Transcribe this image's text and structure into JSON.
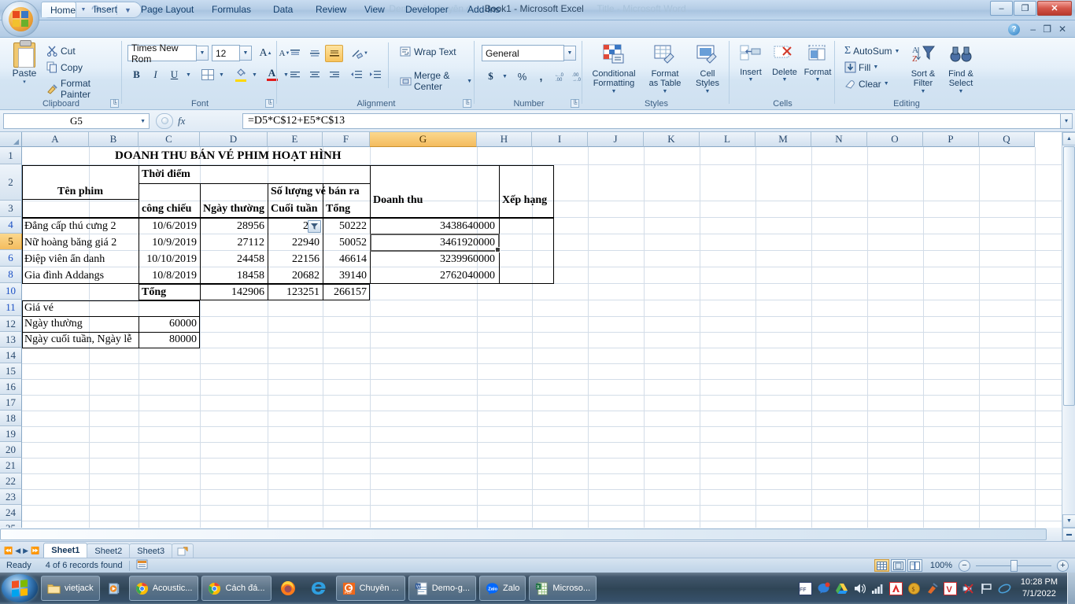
{
  "window": {
    "title": "Book1 - Microsoft Excel",
    "ghost_left": "Demo gửi chuyên đ",
    "ghost_right": "Title - Microsoft Word",
    "minimize": "–",
    "restore": "❐",
    "close": "✕"
  },
  "quick_access": {
    "save": "save-icon",
    "undo": "↶",
    "redo": "↷",
    "customize": "▾"
  },
  "ribbon": {
    "tabs": [
      {
        "label": "Home",
        "active": true
      },
      {
        "label": "Insert",
        "active": false
      },
      {
        "label": "Page Layout",
        "active": false
      },
      {
        "label": "Formulas",
        "active": false
      },
      {
        "label": "Data",
        "active": false
      },
      {
        "label": "Review",
        "active": false
      },
      {
        "label": "View",
        "active": false
      },
      {
        "label": "Developer",
        "active": false
      },
      {
        "label": "Add-Ins",
        "active": false
      }
    ],
    "help": "?",
    "min_ribbon": "–",
    "restore_ribbon": "❐",
    "close_ribbon": "✕",
    "groups": {
      "clipboard": {
        "label": "Clipboard",
        "paste": "Paste",
        "paste_arrow": "▾",
        "cut": "Cut",
        "copy": "Copy",
        "format_painter": "Format Painter"
      },
      "font": {
        "label": "Font",
        "font_name": "Times New Rom",
        "font_size": "12",
        "grow": "A",
        "shrink": "A",
        "bold": "B",
        "italic": "I",
        "underline": "U",
        "borders": "borders-icon",
        "fill_color": "fill-color-icon",
        "font_color": "A"
      },
      "alignment": {
        "label": "Alignment",
        "top_align": "top-align-icon",
        "middle_align": "middle-align-icon",
        "bottom_align": "bottom-align-icon",
        "orientation": "orientation-icon",
        "align_left": "align-left-icon",
        "align_center": "align-center-icon",
        "align_right": "align-right-icon",
        "decrease_indent": "decrease-indent-icon",
        "increase_indent": "increase-indent-icon",
        "wrap_text": "Wrap Text",
        "merge_center": "Merge & Center"
      },
      "number": {
        "label": "Number",
        "format": "General",
        "currency": "$",
        "percent": "%",
        "comma": ",",
        "increase_decimal": ".00",
        "decrease_decimal": ".00"
      },
      "styles": {
        "label": "Styles",
        "conditional_formatting": "Conditional\nFormatting",
        "format_as_table": "Format\nas Table",
        "cell_styles": "Cell\nStyles"
      },
      "cells": {
        "label": "Cells",
        "insert": "Insert",
        "delete": "Delete",
        "format": "Format"
      },
      "editing": {
        "label": "Editing",
        "autosum": "AutoSum",
        "fill": "Fill",
        "clear": "Clear",
        "sort_filter": "Sort &\nFilter",
        "find_select": "Find &\nSelect"
      }
    }
  },
  "formula_bar": {
    "name_box": "G5",
    "formula": "=D5*C$12+E5*C$13",
    "fx": "fx",
    "cancel": "cancel-icon",
    "expand": "▾"
  },
  "sheet": {
    "columns": [
      "A",
      "B",
      "C",
      "D",
      "E",
      "F",
      "G",
      "H",
      "I",
      "J",
      "K",
      "L",
      "M",
      "N",
      "O",
      "P",
      "Q"
    ],
    "selected_column": "G",
    "selected_row": "5",
    "rows": [
      "1",
      "2",
      "3",
      "4",
      "5",
      "6",
      "8",
      "10",
      "11",
      "12",
      "13",
      "14",
      "15",
      "16",
      "17",
      "18",
      "19",
      "20",
      "21",
      "22",
      "23",
      "24",
      "25"
    ],
    "filtered_rows": [
      "4",
      "6",
      "8",
      "10",
      "11"
    ],
    "title_cell": "DOANH THU BÁN VÉ PHIM HOẠT HÌNH",
    "headers": {
      "ten_phim": "Tên phim",
      "thoi_diem": "Thời điểm",
      "cong_chieu": "công chiếu",
      "so_luong": "Số lượng vé bán ra",
      "ngay_thuong": "Ngày thường",
      "cuoi_tuan": "Cuối tuần",
      "tong": "Tổng",
      "doanh_thu": "Doanh thu",
      "xep_hang": "Xếp hạng"
    },
    "data_rows": [
      {
        "row": "4",
        "name": "Đẳng cấp thú cưng 2",
        "date": "10/6/2019",
        "weekday": "28956",
        "weekend": "212",
        "total": "50222",
        "revenue": "3438640000",
        "rank": ""
      },
      {
        "row": "5",
        "name": "Nữ hoàng băng giá 2",
        "date": "10/9/2019",
        "weekday": "27112",
        "weekend": "22940",
        "total": "50052",
        "revenue": "3461920000",
        "rank": ""
      },
      {
        "row": "6",
        "name": "Điệp viên ẩn danh",
        "date": "10/10/2019",
        "weekday": "24458",
        "weekend": "22156",
        "total": "46614",
        "revenue": "3239960000",
        "rank": ""
      },
      {
        "row": "8",
        "name": "Gia đình Addangs",
        "date": "10/8/2019",
        "weekday": "18458",
        "weekend": "20682",
        "total": "39140",
        "revenue": "2762040000",
        "rank": ""
      }
    ],
    "total_row": {
      "row": "10",
      "label": "Tổng",
      "weekday": "142906",
      "weekend": "123251",
      "total": "266157"
    },
    "price_block": [
      {
        "row": "11",
        "label": "Giá vé",
        "value": ""
      },
      {
        "row": "12",
        "label": "Ngày thường",
        "value": "60000"
      },
      {
        "row": "13",
        "label": "Ngày cuối tuần, Ngày lễ",
        "value": "80000"
      }
    ],
    "autofilter_button": "filter-dropdown-icon"
  },
  "sheet_tabs": {
    "first": "⏮",
    "prev": "◀",
    "next": "▶",
    "last": "⏭",
    "items": [
      {
        "label": "Sheet1",
        "active": true
      },
      {
        "label": "Sheet2",
        "active": false
      },
      {
        "label": "Sheet3",
        "active": false
      }
    ],
    "new_sheet": "new-sheet-icon"
  },
  "status_bar": {
    "mode": "Ready",
    "records": "4 of 6 records found",
    "macro_icon": "record-macro-icon",
    "view_normal": "normal-view-icon",
    "view_layout": "page-layout-view-icon",
    "view_break": "page-break-view-icon",
    "zoom": "100%",
    "zoom_out": "−",
    "zoom_in": "+"
  },
  "taskbar": {
    "start": "start-orb-icon",
    "items": [
      {
        "label": "vietjack",
        "icon": "folder-icon"
      },
      {
        "label": "",
        "icon": "media-player-icon"
      },
      {
        "label": "Acoustic...",
        "icon": "chrome-icon"
      },
      {
        "label": "Cách đá...",
        "icon": "chrome-icon"
      },
      {
        "label": "",
        "icon": "firefox-icon"
      },
      {
        "label": "",
        "icon": "internet-explorer-icon"
      },
      {
        "label": "Chuyên ...",
        "icon": "foxit-pdf-icon"
      },
      {
        "label": "Demo-g...",
        "icon": "word-icon"
      },
      {
        "label": "Zalo",
        "icon": "zalo-icon"
      },
      {
        "label": "Microso...",
        "icon": "excel-icon"
      }
    ],
    "tray": [
      "ffa-icon",
      "zalo-tray-icon",
      "google-drive-icon",
      "volume-icon",
      "network-icon",
      "avira-icon",
      "coin-icon",
      "cleaner-icon",
      "v-icon",
      "unikey-icon",
      "flag-icon",
      "ie-tray-icon"
    ],
    "time": "10:28 PM",
    "date": "7/1/2022"
  }
}
